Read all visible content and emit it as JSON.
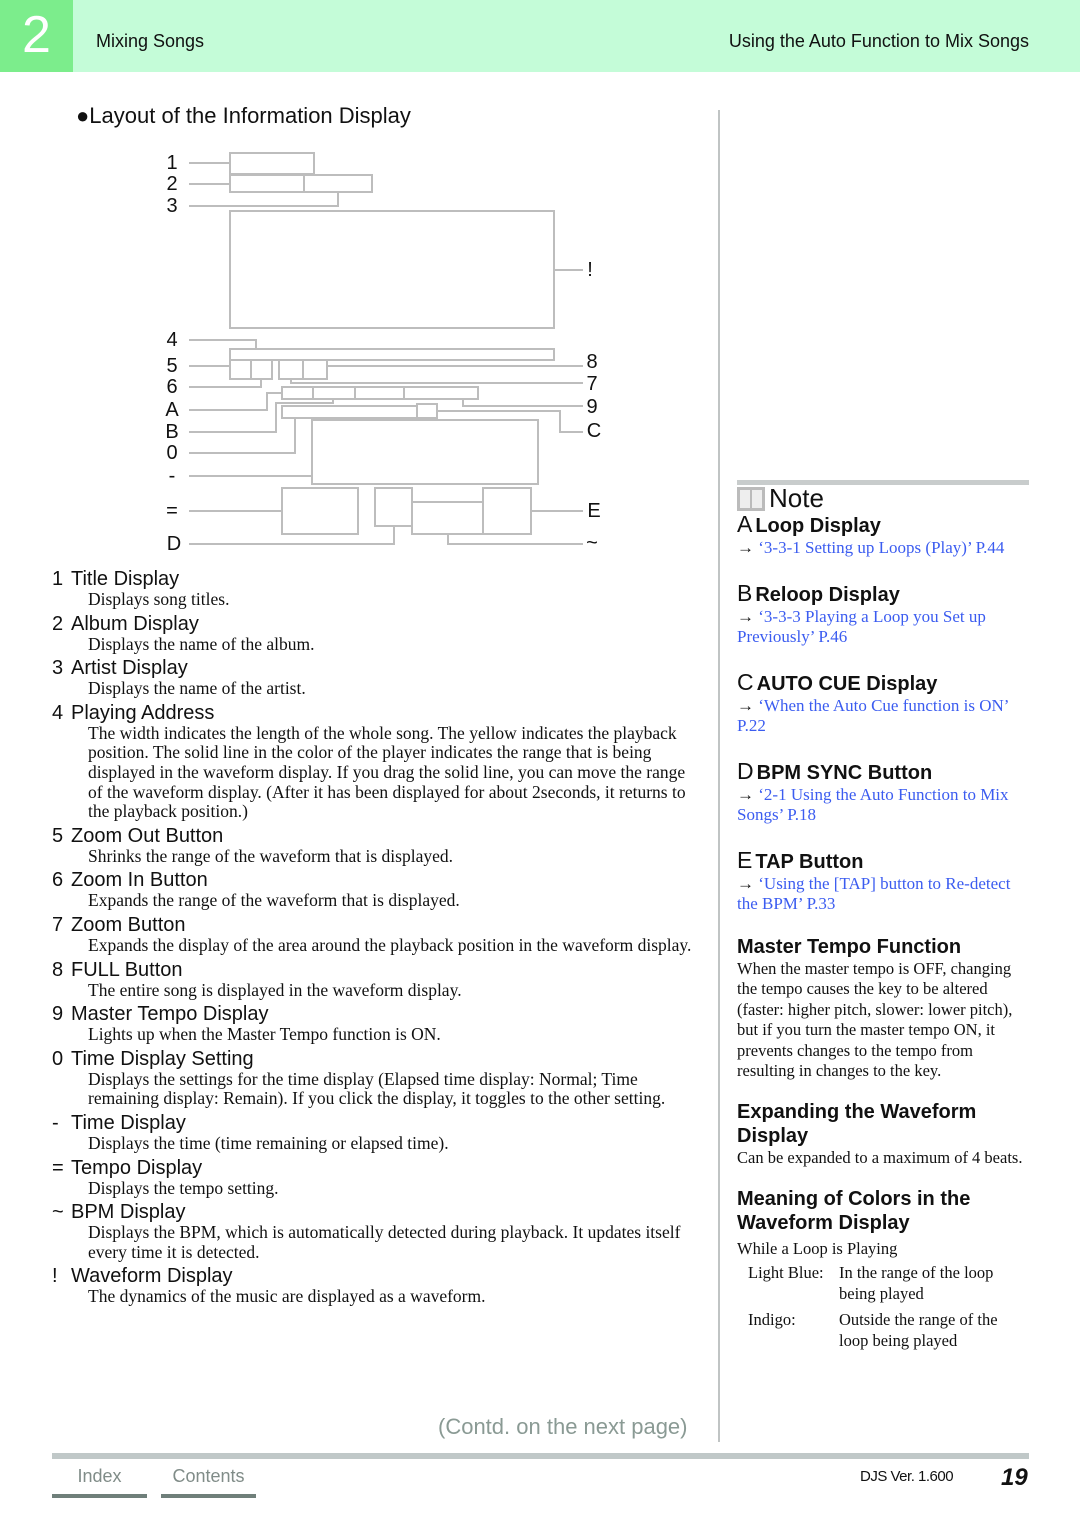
{
  "header": {
    "chapter": "2",
    "left": "Mixing Songs",
    "right": "Using the Auto Function to Mix Songs"
  },
  "section_title": "●Layout of the Information Display",
  "diagram_labels": {
    "l1": "1",
    "l2": "2",
    "l3": "3",
    "l4": "4",
    "l5": "5",
    "l6": "6",
    "lA": "A",
    "lB": "B",
    "l0": "0",
    "lminus": "-",
    "leq": "=",
    "lD": "D",
    "rex": "!",
    "r8": "8",
    "r7": "7",
    "r9": "9",
    "rC": "C",
    "rE": "E",
    "rtilde": "~"
  },
  "items": [
    {
      "key": "1",
      "title": "Title Display",
      "desc": "Displays song titles."
    },
    {
      "key": "2",
      "title": "Album Display",
      "desc": "Displays the name of the album."
    },
    {
      "key": "3",
      "title": "Artist Display",
      "desc": "Displays the name of the artist."
    },
    {
      "key": "4",
      "title": "Playing Address",
      "desc": "The width indicates the length of the whole song. The yellow indicates the playback position. The solid line in the color of the player indicates the range that is being displayed in the waveform display. If you drag the solid line, you can move the range of the waveform display. (After it has been displayed for about 2seconds, it returns to the playback position.)"
    },
    {
      "key": "5",
      "title": "Zoom Out Button",
      "desc": "Shrinks the range of the waveform that is displayed."
    },
    {
      "key": "6",
      "title": "Zoom In Button",
      "desc": "Expands the range of the waveform that is displayed."
    },
    {
      "key": "7",
      "title": "Zoom Button",
      "desc": "Expands the display of the area around the playback position in the waveform display."
    },
    {
      "key": "8",
      "title": "FULL Button",
      "desc": "The entire song is displayed in the waveform display."
    },
    {
      "key": "9",
      "title": "Master Tempo Display",
      "desc": "Lights up when the Master Tempo function is ON."
    },
    {
      "key": "0",
      "title": "Time Display Setting",
      "desc": "Displays the settings for the time display (Elapsed time display: Normal; Time remaining display: Remain). If you click the display, it toggles to the other setting."
    },
    {
      "key": "-",
      "title": "Time Display",
      "desc": "Displays the time (time remaining or elapsed time)."
    },
    {
      "key": "=",
      "title": "Tempo Display",
      "desc": "Displays the tempo setting."
    },
    {
      "key": "~",
      "title": "BPM Display",
      "desc": "Displays the BPM, which is automatically detected during playback. It updates itself every time it is detected."
    },
    {
      "key": "!",
      "title": "Waveform Display",
      "desc": "The dynamics of the music are displayed as a waveform."
    }
  ],
  "contd": "(Contd. on the next page)",
  "note": {
    "title": "Note",
    "arrow": "→",
    "refs": [
      {
        "key": "A",
        "title": "Loop Display",
        "link": "‘3-3-1 Setting up Loops (Play)’ P.44"
      },
      {
        "key": "B",
        "title": "Reloop Display",
        "link": "‘3-3-3 Playing a Loop you Set up Previously’ P.46"
      },
      {
        "key": "C",
        "title": "AUTO CUE Display",
        "link": "‘When the Auto Cue function is ON’ P.22"
      },
      {
        "key": "D",
        "title": "BPM SYNC Button",
        "link": "‘2-1 Using the Auto Function to Mix Songs’ P.18"
      },
      {
        "key": "E",
        "title": "TAP Button",
        "link": "‘Using the [TAP] button to Re-detect the BPM’ P.33"
      }
    ],
    "master_tempo": {
      "title": "Master Tempo Function",
      "body": "When the master tempo is OFF, changing the tempo causes the key to be altered (faster: higher pitch, slower: lower pitch), but if you turn the master tempo ON, it prevents changes to the tempo from resulting in changes to the key."
    },
    "expanding": {
      "title": "Expanding the Waveform Display",
      "body": "Can be expanded to a maximum of 4 beats."
    },
    "colors": {
      "title": "Meaning of Colors in the Waveform Display",
      "intro": "While a Loop is Playing",
      "rows": [
        {
          "term": "Light Blue:",
          "desc": "In the range of the loop being played"
        },
        {
          "term": "Indigo:",
          "desc": "Outside the range of the loop being played"
        }
      ]
    },
    "link_color": "#3b5cf0"
  },
  "footer": {
    "index": "Index",
    "contents": "Contents",
    "version": "DJS Ver. 1.600",
    "page": "19"
  },
  "colors": {
    "header_bg": "#c4fcd8",
    "chapter_bg": "#7ced8c"
  }
}
